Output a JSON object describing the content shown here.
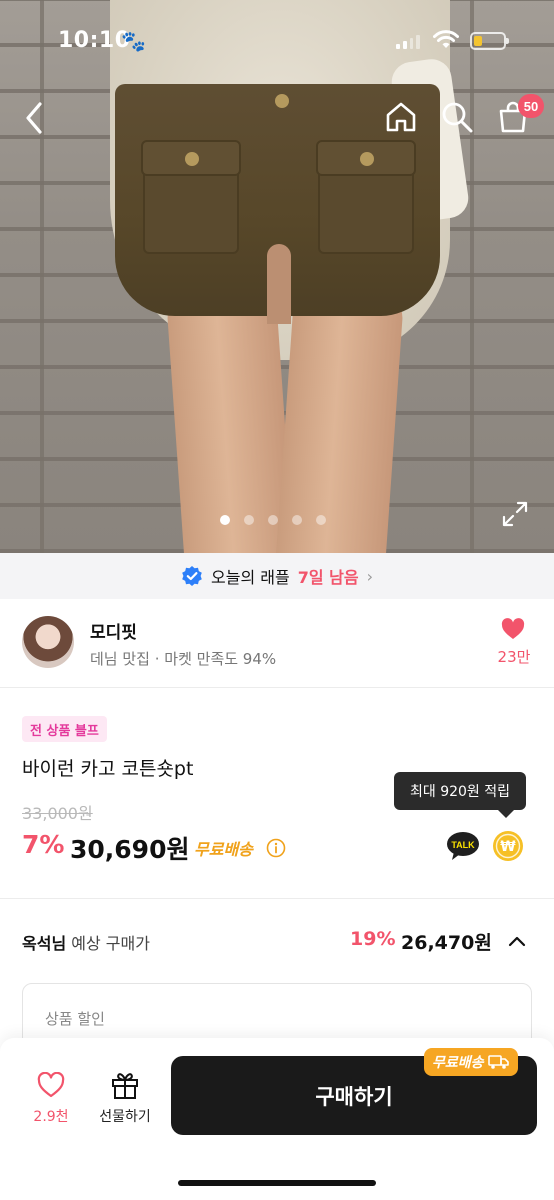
{
  "status_bar": {
    "time": "10:10",
    "paw": "🐾"
  },
  "nav": {
    "cart_count": "50"
  },
  "gallery": {
    "total_images": 5,
    "active_index": 0
  },
  "raffle": {
    "label": "오늘의 래플",
    "days_left": "7일 남음"
  },
  "seller": {
    "name": "모디핏",
    "description": "데님 맛집 · 마켓 만족도 94%",
    "likes": "23만"
  },
  "product": {
    "badge": "전 상품 블프",
    "title": "바이런 카고 코튼숏pt",
    "original_price": "33,000원",
    "discount_rate": "7%",
    "price": "30,690원",
    "shipping": "무료배송",
    "points_tooltip": "최대 920원 적립",
    "talk_label": "TALK",
    "won_symbol": "₩"
  },
  "expected": {
    "user": "옥석님",
    "label": "예상 구매가",
    "discount_rate": "19%",
    "price": "26,470원",
    "section_label": "상품 할인"
  },
  "bottom_bar": {
    "like_count": "2.9천",
    "gift_label": "선물하기",
    "buy_label": "구매하기",
    "shipping_tag": "무료배송"
  },
  "colors": {
    "accent": "#f2546b",
    "shipping": "#f0a21b",
    "buy_button": "#1a1a1a",
    "sale_badge_bg": "#fde8f4",
    "sale_badge_text": "#e43a9c"
  }
}
